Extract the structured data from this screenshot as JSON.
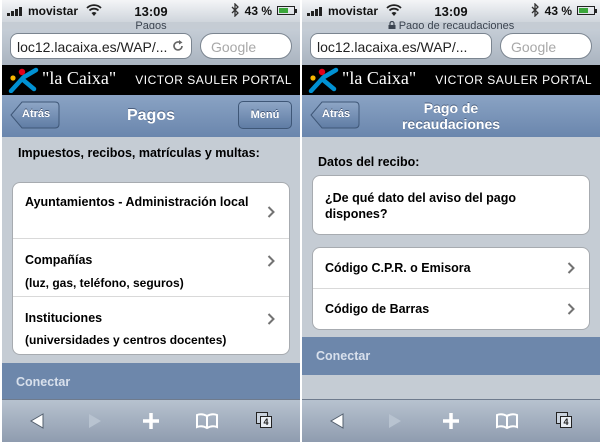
{
  "left": {
    "status": {
      "carrier": "movistar",
      "time": "13:09",
      "battery": "43 %"
    },
    "page_title": "Pagos",
    "url": "loc12.lacaixa.es/WAP/...",
    "search_placeholder": "Google",
    "brand": "\"la Caixa\"",
    "user": "VICTOR SAULER PORTAL",
    "nav": {
      "back": "Atrás",
      "title": "Pagos",
      "menu": "Menú"
    },
    "section_label": "Impuestos, recibos, matrículas y multas:",
    "items": [
      {
        "line1": "Ayuntamientos - Administración local",
        "line2": ""
      },
      {
        "line1": "Compañías",
        "line2": "(luz, gas, teléfono, seguros)"
      },
      {
        "line1": "Instituciones",
        "line2": "(universidades y centros docentes)"
      }
    ],
    "connect": "Conectar",
    "tabs_count": "4"
  },
  "right": {
    "status": {
      "carrier": "movistar",
      "time": "13:09",
      "battery": "43 %"
    },
    "page_title": "Pago de recaudaciones",
    "url": "loc12.lacaixa.es/WAP/...",
    "search_placeholder": "Google",
    "brand": "\"la Caixa\"",
    "user": "VICTOR SAULER PORTAL",
    "nav": {
      "back": "Atrás",
      "title_line1": "Pago de",
      "title_line2": "recaudaciones"
    },
    "section_label": "Datos del recibo:",
    "question": "¿De qué dato del aviso del pago dispones?",
    "items": [
      {
        "line1": "Código C.P.R. o Emisora"
      },
      {
        "line1": "Código de Barras"
      }
    ],
    "connect": "Conectar",
    "tabs_count": "4"
  }
}
